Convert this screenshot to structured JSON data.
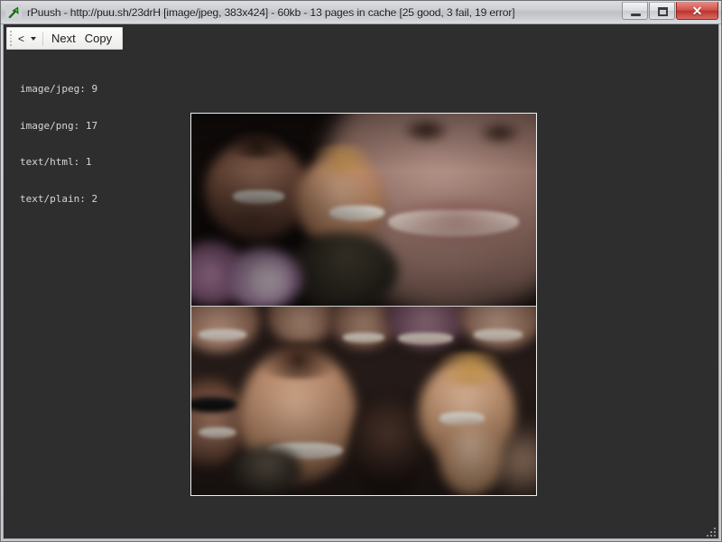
{
  "window": {
    "app_name": "rPuush",
    "title": "rPuush - http://puu.sh/23drH [image/jpeg, 383x424] - 60kb - 13 pages in cache [25 good, 3 fail, 19 error]",
    "icon": "green-arrow-icon",
    "controls": {
      "minimize_label": "–",
      "maximize_label": "□",
      "close_label": "✕"
    }
  },
  "toolbar": {
    "gripper": "toolbar-gripper",
    "back_label": "<",
    "back_dropdown": "chevron-down-icon",
    "next_label": "Next",
    "copy_label": "Copy"
  },
  "stats": {
    "lines": [
      {
        "type": "image/jpeg",
        "count": 9,
        "text": "image/jpeg: 9"
      },
      {
        "type": "image/png",
        "count": 17,
        "text": "image/png: 17"
      },
      {
        "type": "text/html",
        "count": 1,
        "text": "text/html: 1"
      },
      {
        "type": "text/plain",
        "count": 2,
        "text": "text/plain: 2"
      }
    ]
  },
  "viewer": {
    "url": "http://puu.sh/23drH",
    "mime": "image/jpeg",
    "dimensions": "383x424",
    "size": "60kb",
    "cache_summary": "13 pages in cache",
    "cache_good": 25,
    "cache_fail": 3,
    "cache_error": 19,
    "image_description": "Photo collage meme of many laughing male faces, split into an upper and lower panel"
  },
  "colors": {
    "canvas_background": "#2e2e2e",
    "titlebar_gradient_top": "#dcdde1",
    "titlebar_gradient_bottom": "#dbdce0",
    "close_button": "#bb342e",
    "toolbar_background": "#fdfdfd",
    "stats_text": "#d7d7d7",
    "image_border": "#f0f0f0"
  }
}
